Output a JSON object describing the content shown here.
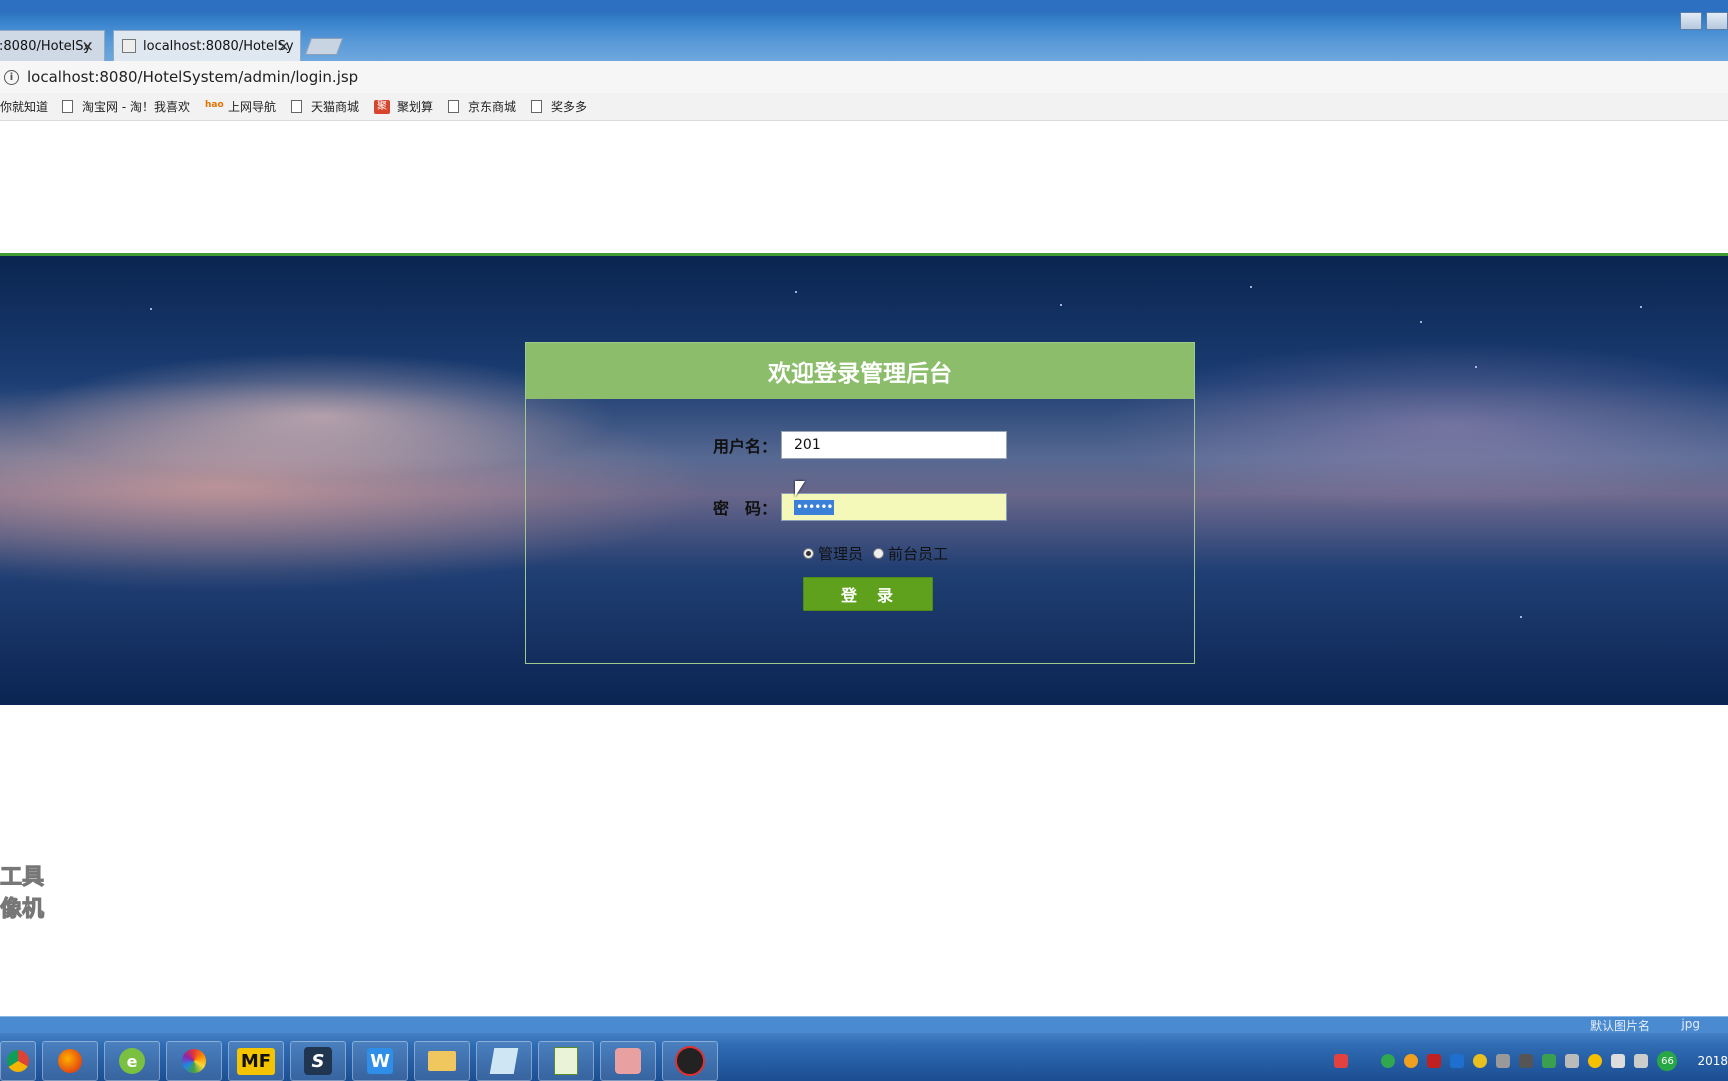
{
  "browser": {
    "tabs": [
      {
        "label": ":8080/HotelSy",
        "active": false
      },
      {
        "label": "localhost:8080/HotelSy",
        "active": true
      }
    ],
    "address": "localhost:8080/HotelSystem/admin/login.jsp",
    "bookmarks": [
      "你就知道",
      "淘宝网 - 淘！我喜欢",
      "上网导航",
      "天猫商城",
      "聚划算",
      "京东商城",
      "奖多多"
    ],
    "bookmark_icons": {
      "hao": "hao"
    }
  },
  "login": {
    "title": "欢迎登录管理后台",
    "username_label": "用户名：",
    "username_value": "201",
    "password_label": "密　码：",
    "password_masked": "••••••",
    "roles": [
      {
        "label": "管理员",
        "selected": true
      },
      {
        "label": "前台员工",
        "selected": false
      }
    ],
    "submit_label": "登录"
  },
  "watermark": {
    "line1": "工具",
    "line2": "像机"
  },
  "taskbar": {
    "apps": [
      "chrome",
      "firefox",
      "360-browser",
      "picasa",
      "MF",
      "sublime",
      "W",
      "file-explorer",
      "notepad",
      "chart-editor",
      "camera",
      "qq-robot"
    ],
    "mf_label": "MF",
    "w_label": "W",
    "badge": "66",
    "clock": "2018",
    "tray_note_left": "默认图片名",
    "tray_note_right": "jpg"
  },
  "colors": {
    "panel_header": "#8bbd6a",
    "submit": "#5fa11c",
    "accent_line": "#3f9b32"
  }
}
